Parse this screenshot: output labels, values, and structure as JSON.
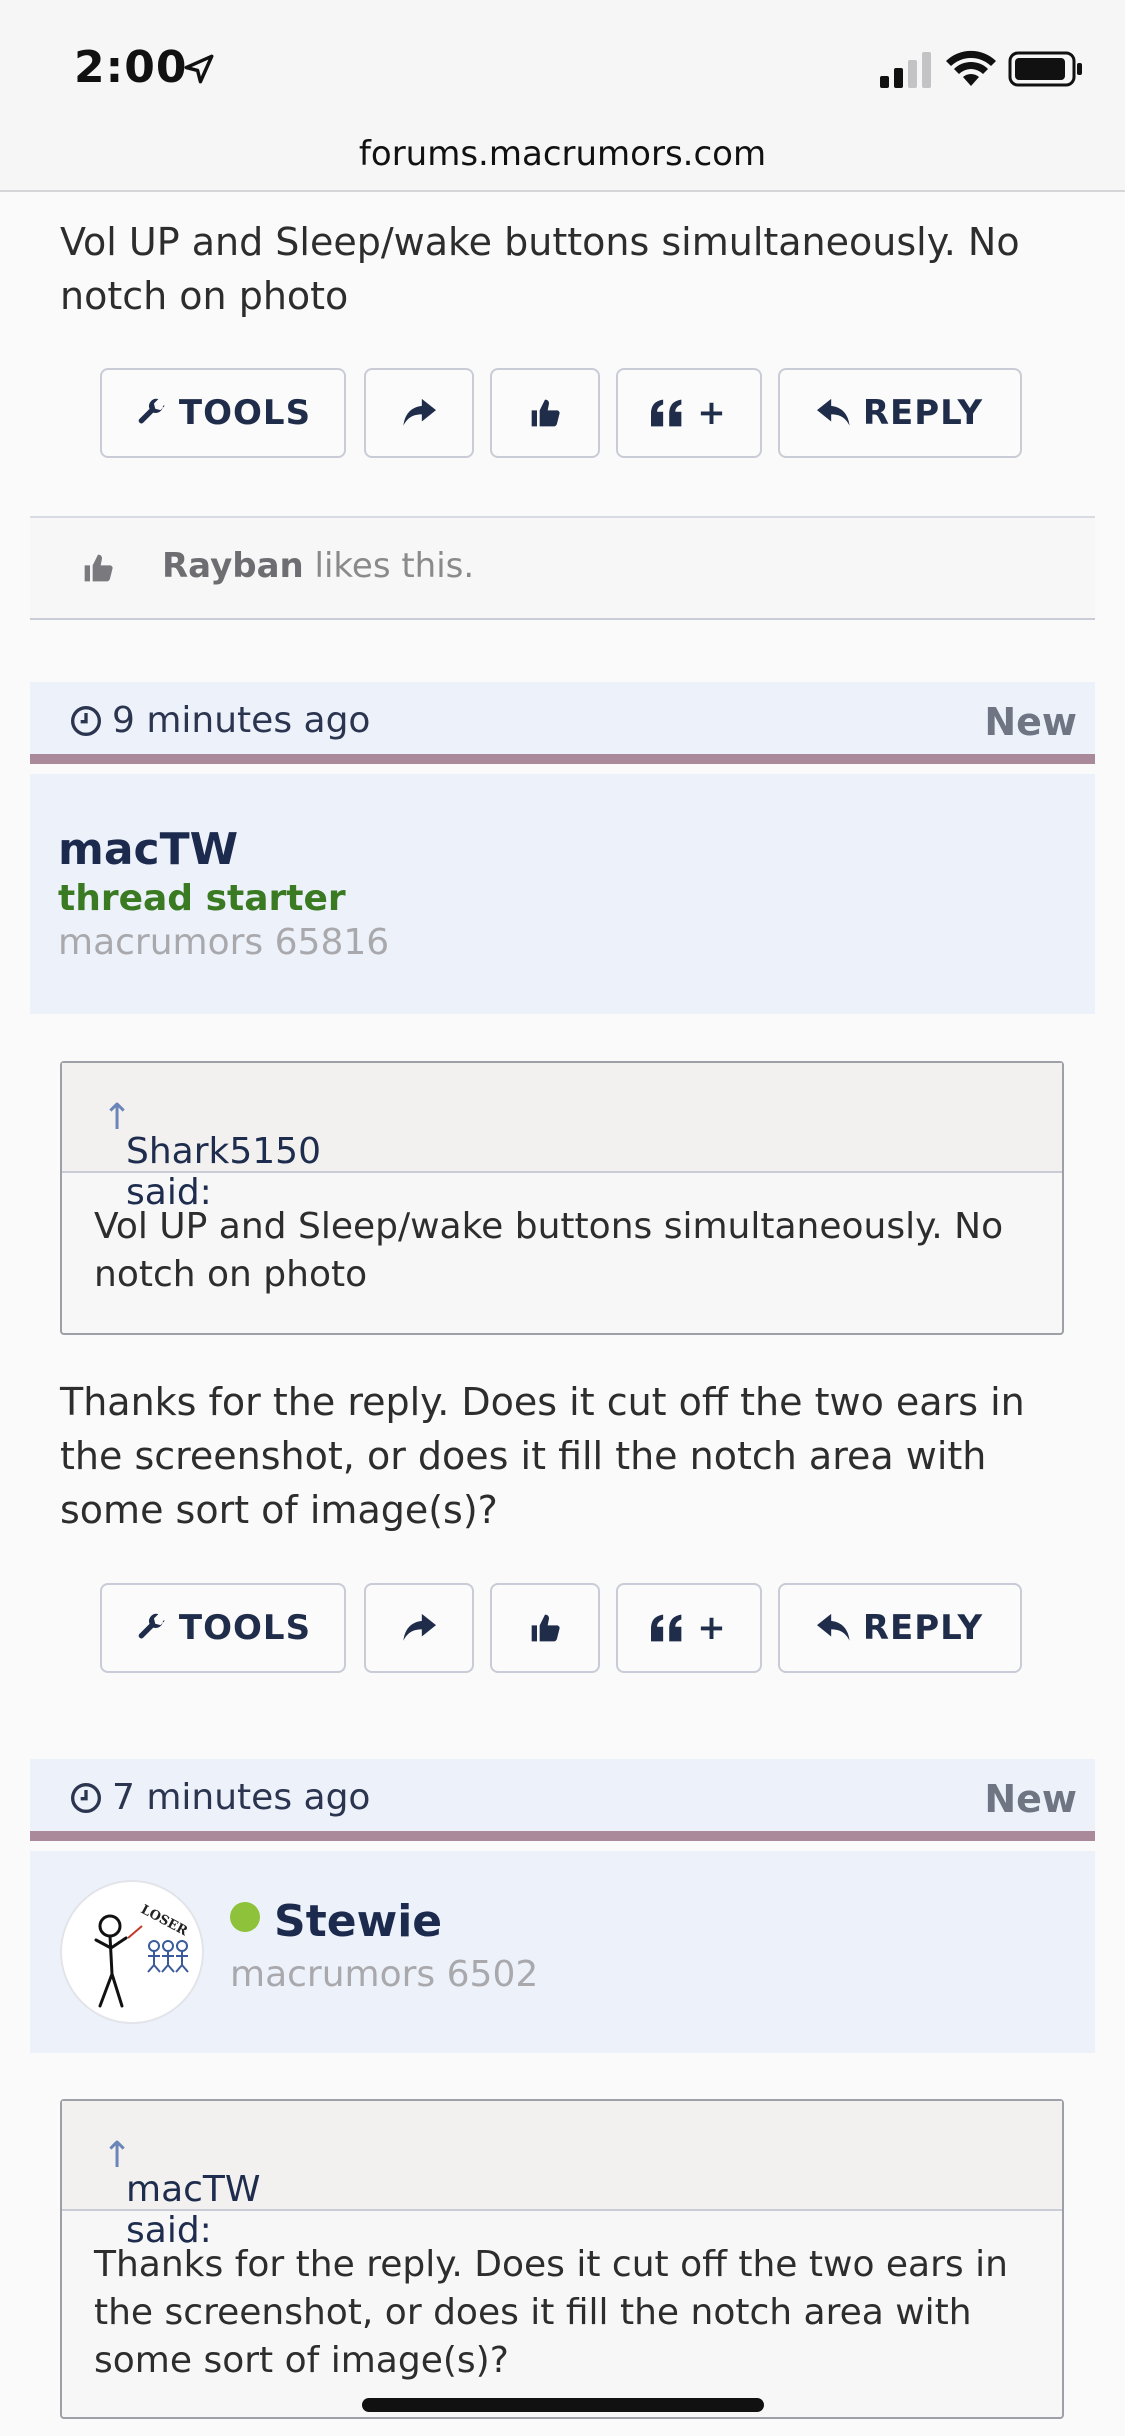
{
  "status_bar": {
    "time": "2:00",
    "url": "forums.macrumors.com"
  },
  "post1": {
    "text": "Vol UP and Sleep/wake buttons simultaneously. No notch on photo"
  },
  "buttons": {
    "tools": "TOOLS",
    "reply": "REPLY",
    "quote_plus": "+"
  },
  "likes": {
    "user": "Rayban",
    "suffix": " likes this."
  },
  "post2": {
    "time_ago": "9 minutes ago",
    "badge": "New",
    "username": "macTW",
    "status": "thread starter",
    "rank": "macrumors 65816",
    "quote": {
      "header": "Shark5150 said:",
      "arrow": "↑",
      "text": "Vol UP and Sleep/wake buttons simultaneously. No notch on photo"
    },
    "text": "Thanks for the reply. Does it cut off the two ears in the screenshot, or does it fill the notch area with some sort of image(s)?"
  },
  "post3": {
    "time_ago": "7 minutes ago",
    "badge": "New",
    "username": "Stewie",
    "rank": "macrumors 6502",
    "avatar_text": "LOSER",
    "quote": {
      "header": "macTW said:",
      "arrow": "↑",
      "text": "Thanks for the reply. Does it cut off the two ears in the screenshot, or does it fill the notch area with some sort of image(s)?"
    }
  },
  "colors": {
    "accent_bar": "#a9899a",
    "user_block_bg": "#edf2fa",
    "username": "#1b2a4d",
    "thread_starter": "#3a7a22",
    "online": "#8ec23b"
  }
}
